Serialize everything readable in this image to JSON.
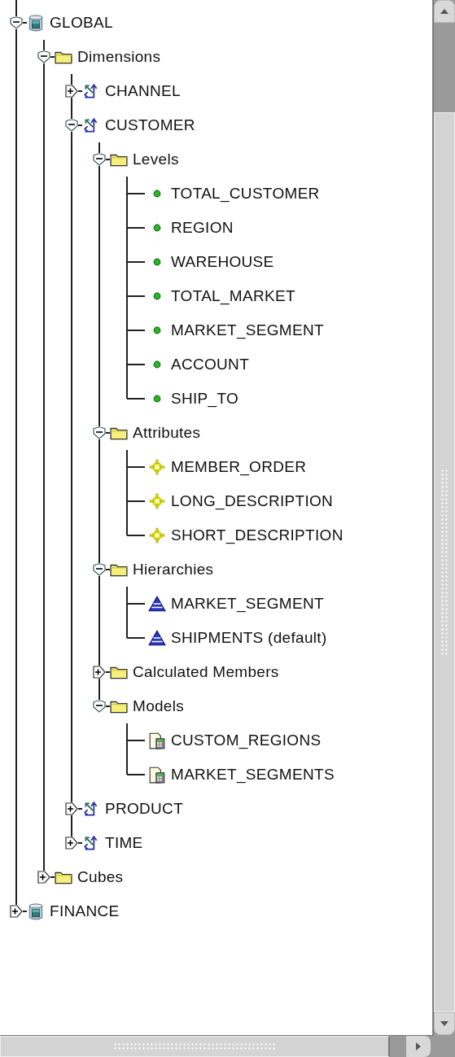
{
  "tree": [
    {
      "label": "GLOBAL",
      "kind": "database",
      "expanded": true,
      "children": [
        {
          "label": "Dimensions",
          "kind": "folder",
          "expanded": true,
          "children": [
            {
              "label": "CHANNEL",
              "kind": "dimension",
              "expanded": false
            },
            {
              "label": "CUSTOMER",
              "kind": "dimension",
              "expanded": true,
              "children": [
                {
                  "label": "Levels",
                  "kind": "folder",
                  "expanded": true,
                  "children": [
                    {
                      "label": "TOTAL_CUSTOMER",
                      "kind": "level"
                    },
                    {
                      "label": "REGION",
                      "kind": "level"
                    },
                    {
                      "label": "WAREHOUSE",
                      "kind": "level"
                    },
                    {
                      "label": "TOTAL_MARKET",
                      "kind": "level"
                    },
                    {
                      "label": "MARKET_SEGMENT",
                      "kind": "level"
                    },
                    {
                      "label": "ACCOUNT",
                      "kind": "level"
                    },
                    {
                      "label": "SHIP_TO",
                      "kind": "level"
                    }
                  ]
                },
                {
                  "label": "Attributes",
                  "kind": "folder",
                  "expanded": true,
                  "children": [
                    {
                      "label": "MEMBER_ORDER",
                      "kind": "attribute"
                    },
                    {
                      "label": "LONG_DESCRIPTION",
                      "kind": "attribute"
                    },
                    {
                      "label": "SHORT_DESCRIPTION",
                      "kind": "attribute"
                    }
                  ]
                },
                {
                  "label": "Hierarchies",
                  "kind": "folder",
                  "expanded": true,
                  "children": [
                    {
                      "label": "MARKET_SEGMENT",
                      "kind": "hierarchy"
                    },
                    {
                      "label": "SHIPMENTS (default)",
                      "kind": "hierarchy"
                    }
                  ]
                },
                {
                  "label": "Calculated Members",
                  "kind": "folder",
                  "expanded": false
                },
                {
                  "label": "Models",
                  "kind": "folder",
                  "expanded": true,
                  "children": [
                    {
                      "label": "CUSTOM_REGIONS",
                      "kind": "model"
                    },
                    {
                      "label": "MARKET_SEGMENTS",
                      "kind": "model"
                    }
                  ]
                }
              ]
            },
            {
              "label": "PRODUCT",
              "kind": "dimension",
              "expanded": false
            },
            {
              "label": "TIME",
              "kind": "dimension",
              "expanded": false
            }
          ]
        },
        {
          "label": "Cubes",
          "kind": "folder",
          "expanded": false
        }
      ]
    },
    {
      "label": "FINANCE",
      "kind": "database",
      "expanded": false
    }
  ]
}
